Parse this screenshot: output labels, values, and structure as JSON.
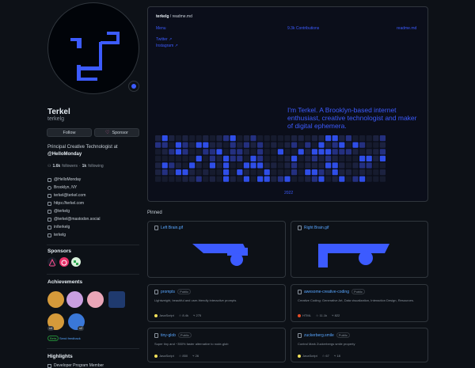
{
  "profile": {
    "name": "Terkel",
    "login": "terkelg",
    "follow_label": "Follow",
    "sponsor_label": "Sponsor",
    "bio_prefix": "Principal Creative Technologist at",
    "bio_org": "@HelloMonday",
    "followers_count": "1.6k",
    "followers_label": "followers",
    "separator": "·",
    "following_count": "1k",
    "following_label": "following",
    "details": [
      "@HelloMonday",
      "Brooklyn, NY",
      "terkel@terkel.com",
      "https://terkel.com",
      "@terkelg",
      "@terkel@mastodon.social",
      "in/terkelg",
      "terkelg"
    ]
  },
  "sidebar": {
    "sponsors_title": "Sponsors",
    "achievements_title": "Achievements",
    "achievement_counts": [
      "x4",
      "x2"
    ],
    "beta_label": "Beta",
    "feedback_label": "Send feedback",
    "highlights_title": "Highlights",
    "highlight_item": "Developer Program Member"
  },
  "readme": {
    "crumb_user": "terkelg",
    "crumb_file": "readme.md",
    "nav_menu": "Menu",
    "nav_contributions": "9.3k Contributions",
    "nav_readme": "readme.md",
    "links": [
      "Twitter ↗",
      "Instagram ↗"
    ],
    "tagline": "I'm Terkel. A Brooklyn-based internet enthusiast, creative technologist and maker of digital ephemera.",
    "year": "2022",
    "grid_accent": "#2f4ee8"
  },
  "pinned": {
    "title": "Pinned",
    "cards": [
      {
        "name": "Left Brain.gif"
      },
      {
        "name": "Right Brain.gif"
      },
      {
        "name": "prompts",
        "visibility": "Public",
        "description": "Lightweight, beautiful and user-friendly interactive prompts",
        "language": "JavaScript",
        "lang_color": "#f1e05a",
        "stars": "8.4k",
        "forks": "275"
      },
      {
        "name": "awesome-creative-coding",
        "visibility": "Public",
        "description": "Creative Coding: Generative Art, Data visualization, Interaction Design, Resources.",
        "language": "HTML",
        "lang_color": "#e34c26",
        "stars": "11.1k",
        "forks": "822"
      },
      {
        "name": "tiny-glob",
        "visibility": "Public",
        "description": "Super tiny and ~350% faster alternative to node-glob",
        "language": "JavaScript",
        "lang_color": "#f1e05a",
        "stars": "850",
        "forks": "26"
      },
      {
        "name": "zuckerberg.smile",
        "visibility": "Public",
        "description": "Control Mark Zuckerbergs smile property",
        "language": "JavaScript",
        "lang_color": "#f1e05a",
        "stars": "67",
        "forks": "18"
      }
    ]
  }
}
